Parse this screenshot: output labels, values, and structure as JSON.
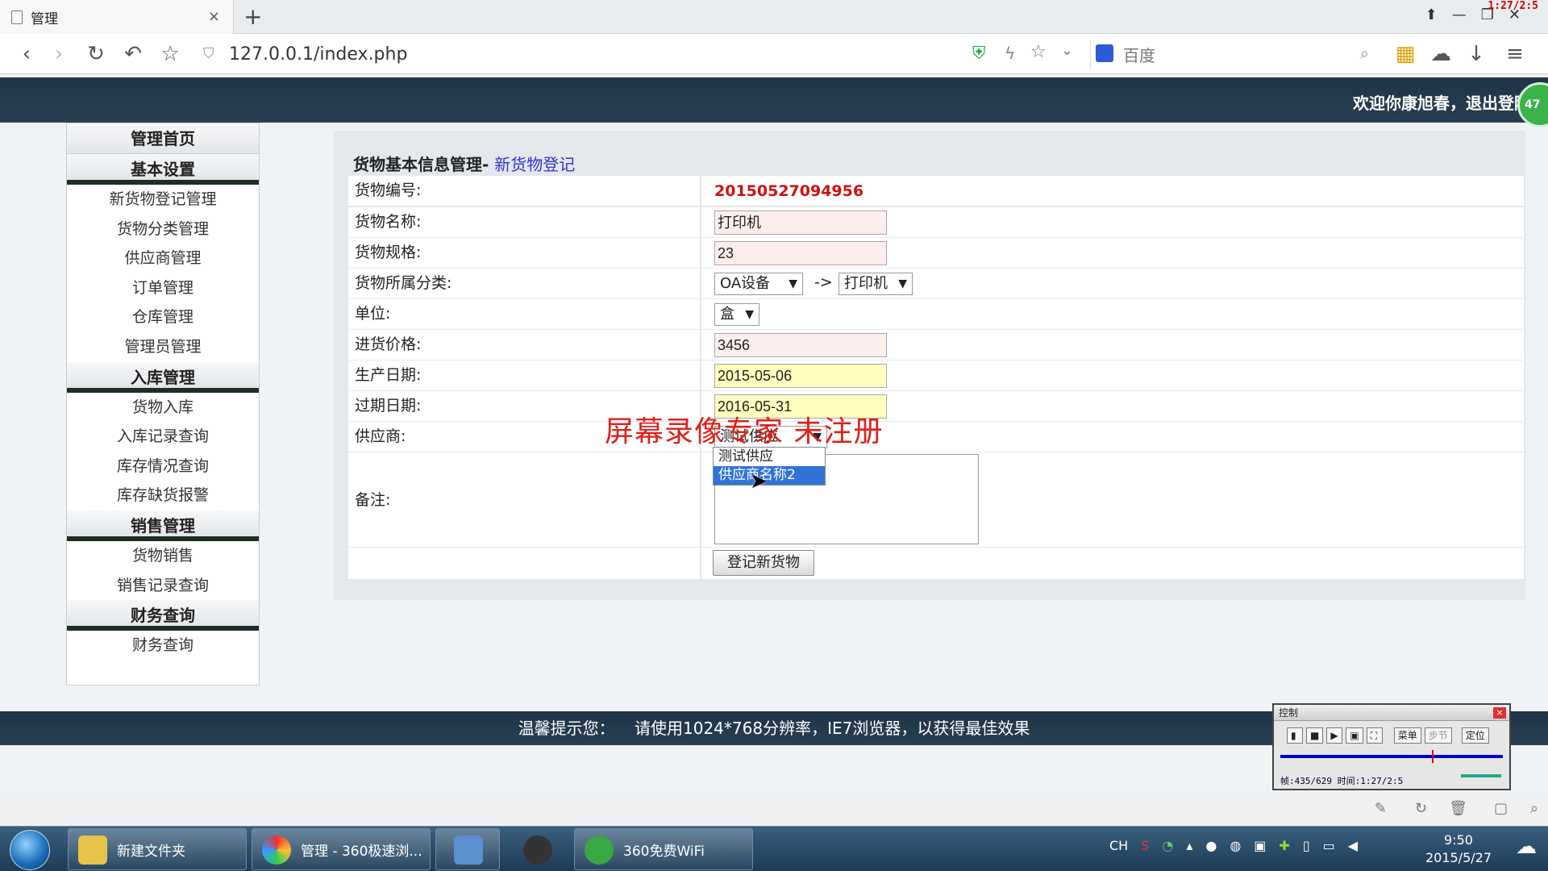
{
  "browser": {
    "tab_title": "管理",
    "tab_close": "×",
    "new_tab": "+",
    "url": "127.0.0.1/index.php",
    "search_placeholder": "百度",
    "recorder_time": "1:27/2:5"
  },
  "header": {
    "welcome": "欢迎你康旭春，退出登陆",
    "avatar_badge": "47"
  },
  "sidebar": {
    "home": "管理首页",
    "sections": [
      {
        "title": "基本设置",
        "items": [
          "新货物登记管理",
          "货物分类管理",
          "供应商管理",
          "订单管理",
          "仓库管理",
          "管理员管理"
        ]
      },
      {
        "title": "入库管理",
        "items": [
          "货物入库",
          "入库记录查询",
          "库存情况查询",
          "库存缺货报警"
        ]
      },
      {
        "title": "销售管理",
        "items": [
          "货物销售",
          "销售记录查询"
        ]
      },
      {
        "title": "财务查询",
        "items": [
          "财务查询"
        ]
      }
    ]
  },
  "form": {
    "title": "货物基本信息管理",
    "title_sep": "- ",
    "title_link": "新货物登记",
    "labels": {
      "code": "货物编号:",
      "name": "货物名称:",
      "spec": "货物规格:",
      "category": "货物所属分类:",
      "unit": "单位:",
      "price": "进货价格:",
      "prod_date": "生产日期:",
      "exp_date": "过期日期:",
      "supplier": "供应商:",
      "remark": "备注:"
    },
    "values": {
      "code": "20150527094956",
      "name": "打印机",
      "spec": "23",
      "category1": "OA设备",
      "arrow": "->",
      "category2": "打印机",
      "unit": "盒",
      "price": "3456",
      "prod_date": "2015-05-06",
      "exp_date": "2016-05-31",
      "supplier": "测试供应"
    },
    "supplier_options": [
      "测试供应",
      "供应商名称2"
    ],
    "highlighted_option": "供应商名称2",
    "submit": "登记新货物"
  },
  "watermark": "屏幕录像专家  未注册",
  "footer": {
    "tip_label": "温馨提示您：",
    "tip": "请使用1024*768分辨率，IE7浏览器，以获得最佳效果"
  },
  "recorder": {
    "title": "控制",
    "menu": "菜单",
    "step": "步节",
    "locate": "定位",
    "info": "帧:435/629 时间:1:27/2:5"
  },
  "taskbar": {
    "items": [
      "新建文件夹",
      "管理 - 360极速浏...",
      "",
      "",
      "360免费WiFi"
    ],
    "lang": "CH",
    "time": "9:50",
    "date": "2015/5/27"
  }
}
